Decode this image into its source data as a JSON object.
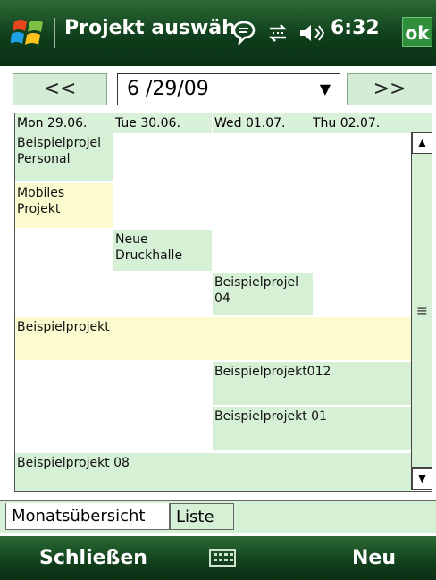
{
  "titlebar": {
    "title": "Projekt auswäh",
    "time": "6:32",
    "ok_label": "ok",
    "icons": [
      "windows-start-icon",
      "message-icon",
      "connectivity-icon",
      "volume-icon"
    ]
  },
  "nav": {
    "prev_label": "<<",
    "date_value": "6 /29/09",
    "dropdown_arrow": "▼",
    "next_label": ">>"
  },
  "calendar": {
    "columns": [
      "Mon 29.06.",
      "Tue 30.06.",
      "Wed 01.07.",
      "Thu 02.07."
    ],
    "events": [
      {
        "line1": "Beispielprojel",
        "line2": "Personal",
        "color": "green"
      },
      {
        "line1": "Mobiles",
        "line2": "Projekt",
        "color": "yellow"
      },
      {
        "line1": "Neue",
        "line2": "Druckhalle",
        "color": "green"
      },
      {
        "line1": "Beispielprojel",
        "line2": "04",
        "color": "green"
      },
      {
        "line1": "Beispielprojekt",
        "line2": "",
        "color": "yellow"
      },
      {
        "line1": "Beispielprojekt012",
        "line2": "",
        "color": "green"
      },
      {
        "line1": "Beispielprojekt 01",
        "line2": "",
        "color": "green"
      },
      {
        "line1": "Beispielprojekt 08",
        "line2": "",
        "color": "green"
      }
    ]
  },
  "scrollbar": {
    "up_arrow": "▲",
    "grip": "≡",
    "down_arrow": "▼"
  },
  "tabs": [
    {
      "label": "Monatsübersicht",
      "active": true
    },
    {
      "label": "Liste",
      "active": false
    }
  ],
  "softkeys": {
    "left_label": "Schließen",
    "right_label": "Neu"
  },
  "colors": {
    "titlebar": "#0f3f1c",
    "event_green": "#d5f0d5",
    "event_yellow": "#fbfbcf",
    "ok_button": "#2f8f3a"
  }
}
